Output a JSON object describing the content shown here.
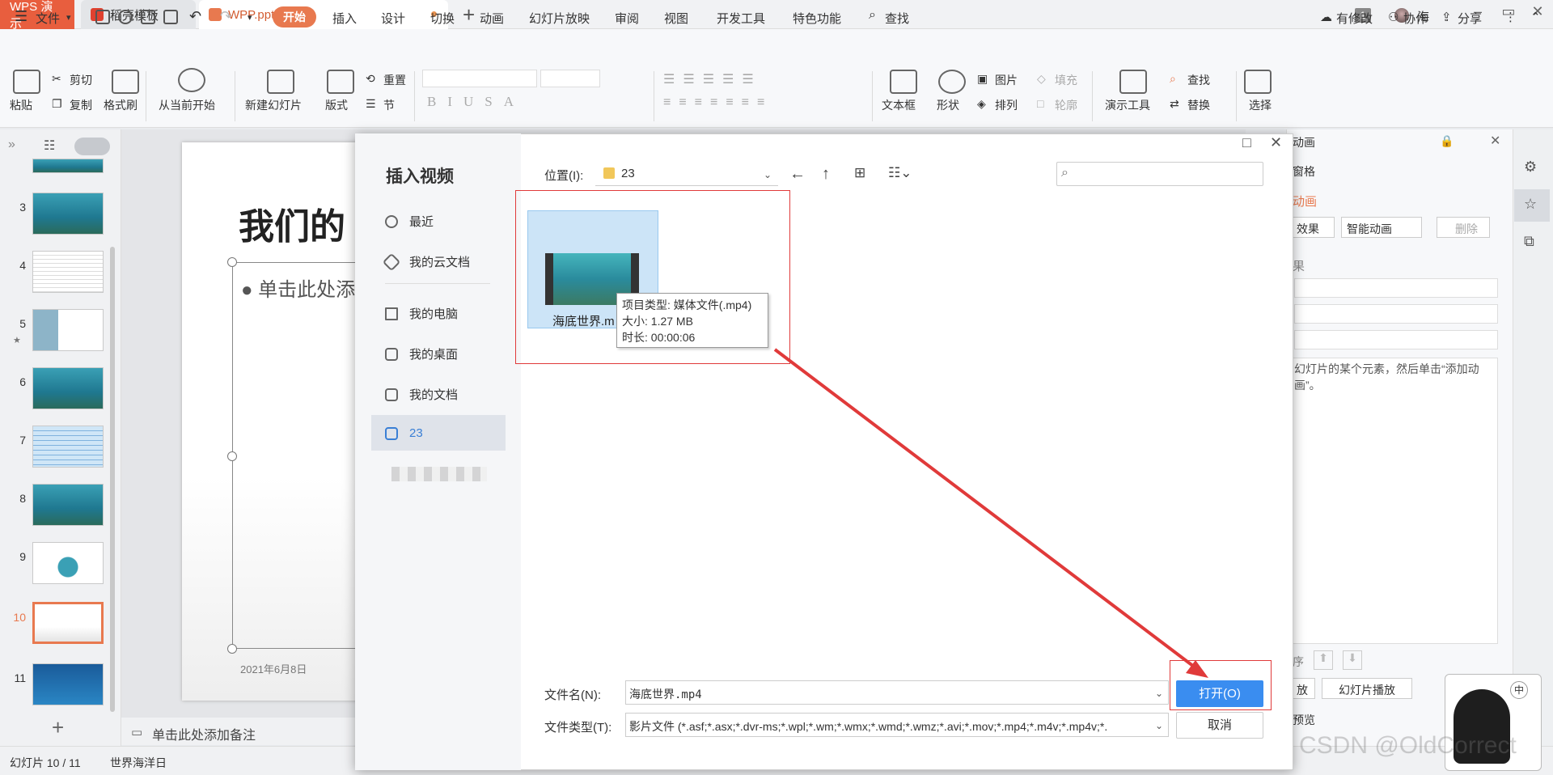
{
  "titlebar": {
    "tabs": [
      {
        "label": "WPS 演示"
      },
      {
        "label": "稻壳模板"
      },
      {
        "label": "WPP.pptx"
      }
    ],
    "window_badge": "1",
    "user": "海"
  },
  "menubar": {
    "file": "文件",
    "items": [
      "开始",
      "插入",
      "设计",
      "切换",
      "动画",
      "幻灯片放映",
      "审阅",
      "视图",
      "开发工具",
      "特色功能"
    ],
    "search": "查找",
    "right": [
      "有修改",
      "协作",
      "分享"
    ]
  },
  "ribbon": {
    "paste": "粘贴",
    "cut": "剪切",
    "copy": "复制",
    "format_painter": "格式刷",
    "from_current": "从当前开始",
    "new_slide": "新建幻灯片",
    "layout": "版式",
    "reset": "重置",
    "section": "节",
    "textbox": "文本框",
    "shape": "形状",
    "picture": "图片",
    "fill": "填充",
    "arrange": "排列",
    "outline": "轮廓",
    "present_tools": "演示工具",
    "find": "查找",
    "replace": "替换",
    "select": "选择"
  },
  "thumbnails": [
    "3",
    "4",
    "5",
    "6",
    "7",
    "8",
    "9",
    "10",
    "11"
  ],
  "slide": {
    "title": "我们的",
    "body": "● 单击此处添",
    "date": "2021年6月8日"
  },
  "notes": "单击此处添加备注",
  "status": {
    "slide_count": "幻灯片 10 / 11",
    "theme": "世界海洋日"
  },
  "rightpane": {
    "header": "动画",
    "window": "窗格",
    "add_anim": "动画",
    "effect": "效果",
    "smart_anim": "智能动画",
    "delete": "删除",
    "effect_label": "果",
    "hint": "幻灯片的某个元素，然后单击“添加动画”。",
    "order": "序",
    "play": "放",
    "slideshow": "幻灯片播放",
    "preview": "预览"
  },
  "dialog": {
    "title": "插入视频",
    "nav": [
      "最近",
      "我的云文档",
      "我的电脑",
      "我的桌面",
      "我的文档",
      "23"
    ],
    "location_label": "位置(I):",
    "location_value": "23",
    "file": {
      "name": "海底世界.m",
      "tooltip_type": "项目类型: 媒体文件(.mp4)",
      "tooltip_size": "大小: 1.27 MB",
      "tooltip_duration": "时长: 00:00:06"
    },
    "filename_label": "文件名(N):",
    "filename_value": "海底世界.mp4",
    "filetype_label": "文件类型(T):",
    "filetype_value": "影片文件 (*.asf;*.asx;*.dvr-ms;*.wpl;*.wm;*.wmx;*.wmd;*.wmz;*.avi;*.mov;*.mp4;*.m4v;*.mp4v;*.",
    "open": "打开(O)",
    "cancel": "取消"
  },
  "watermark": "CSDN @OldCorrect",
  "colors": {
    "accent": "#e8794f",
    "open_button": "#3a8df0",
    "highlight_red": "#e03a3a"
  }
}
